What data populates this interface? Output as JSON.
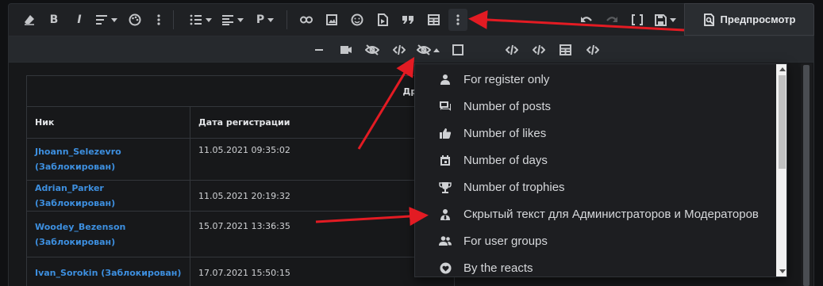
{
  "toolbar": {
    "bold_label": "B",
    "italic_label": "I",
    "paragraph_label": "P",
    "preview_label": "Предпросмотр"
  },
  "menu": {
    "items": [
      {
        "label": "For register only",
        "icon": "person-icon"
      },
      {
        "label": "Number of posts",
        "icon": "comments-icon"
      },
      {
        "label": "Number of likes",
        "icon": "thumbs-up-icon"
      },
      {
        "label": "Number of days",
        "icon": "calendar-icon"
      },
      {
        "label": "Number of trophies",
        "icon": "trophy-icon"
      },
      {
        "label": "Скрытый текст для Администраторов и Модераторов",
        "icon": "user-tie-icon"
      },
      {
        "label": "For user groups",
        "icon": "users-icon"
      },
      {
        "label": "By the reacts",
        "icon": "heart-circle-icon"
      }
    ]
  },
  "table": {
    "title": "Другие ак",
    "headers": [
      "Ник",
      "Дата регистрации"
    ],
    "rows": [
      {
        "user_line1": "Jhoann_Selezevro",
        "user_line2": "(Заблокирован)",
        "date": "11.05.2021 09:35:02"
      },
      {
        "user_line1": "Adrian_Parker (Заблокирован)",
        "user_line2": "",
        "date": "11.05.2021 20:19:32"
      },
      {
        "user_line1": "Woodey_Bezenson",
        "user_line2": "(Заблокирован)",
        "date": "15.07.2021 13:36:35"
      },
      {
        "user_line1": "Ivan_Sorokin (Заблокирован)",
        "user_line2": "",
        "date": "17.07.2021 15:50:15"
      }
    ]
  },
  "colors": {
    "annotation": "#e31b23",
    "link": "#3d8fdf"
  }
}
